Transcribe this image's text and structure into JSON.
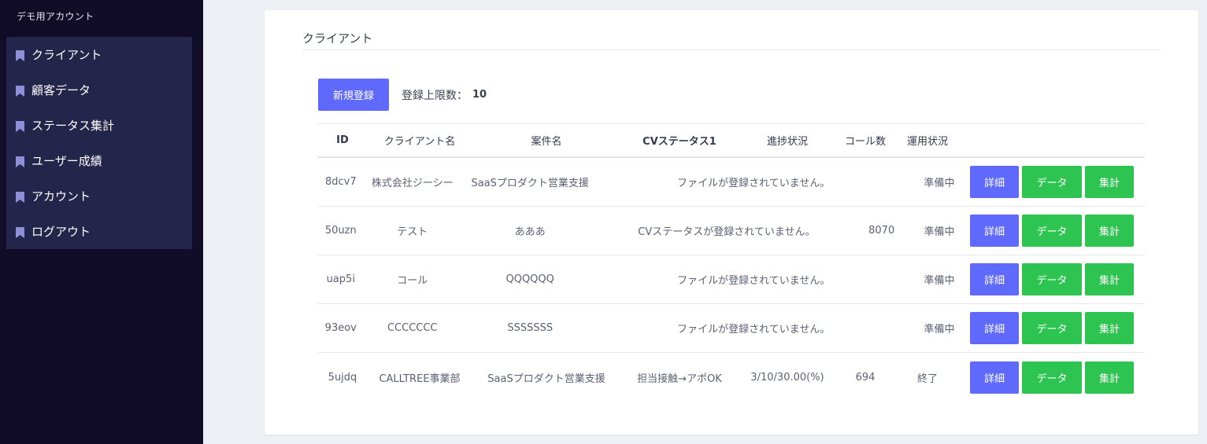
{
  "sidebar": {
    "account_name": "デモ用アカウント",
    "items": [
      {
        "label": "クライアント",
        "icon": "bookmark-icon"
      },
      {
        "label": "顧客データ",
        "icon": "bookmark-icon"
      },
      {
        "label": "ステータス集計",
        "icon": "bookmark-icon"
      },
      {
        "label": "ユーザー成績",
        "icon": "bookmark-icon"
      },
      {
        "label": "アカウント",
        "icon": "bookmark-icon"
      },
      {
        "label": "ログアウト",
        "icon": "bookmark-icon"
      }
    ]
  },
  "main": {
    "title": "クライアント",
    "new_button": "新規登録",
    "limit_label": "登録上限数：",
    "limit_value": "10",
    "table": {
      "headers": [
        "ID",
        "クライアント名",
        "案件名",
        "CVステータス1",
        "進捗状況",
        "コール数",
        "運用状況"
      ],
      "actions": {
        "detail": "詳細",
        "data": "データ",
        "aggregate": "集計"
      },
      "rows": [
        {
          "id": "8dcv7",
          "client": "株式会社ジーシー",
          "project": "SaaSプロダクト営業支援",
          "message": "ファイルが登録されていません。",
          "status": "準備中"
        },
        {
          "id": "50uzn",
          "client": "テスト",
          "project": "あああ",
          "message": "CVステータスが登録されていません。",
          "calls": "8070",
          "status": "準備中"
        },
        {
          "id": "uap5i",
          "client": "コール",
          "project": "QQQQQQ",
          "message": "ファイルが登録されていません。",
          "status": "準備中"
        },
        {
          "id": "93eov",
          "client": "CCCCCCC",
          "project": "SSSSSSS",
          "message": "ファイルが登録されていません。",
          "status": "準備中"
        },
        {
          "id": "5ujdq",
          "client": "CALLTREE事業部",
          "project": "SaaSプロダクト営業支援",
          "cv": "担当接触→アポOK",
          "progress": "3/10/30.00(%)",
          "calls": "694",
          "status": "終了"
        }
      ]
    }
  },
  "colors": {
    "sidebar_bg": "#110d28",
    "nav_item_bg": "#24254a",
    "primary": "#5f6afc",
    "success": "#2ec451",
    "icon": "#8e8fd6"
  }
}
